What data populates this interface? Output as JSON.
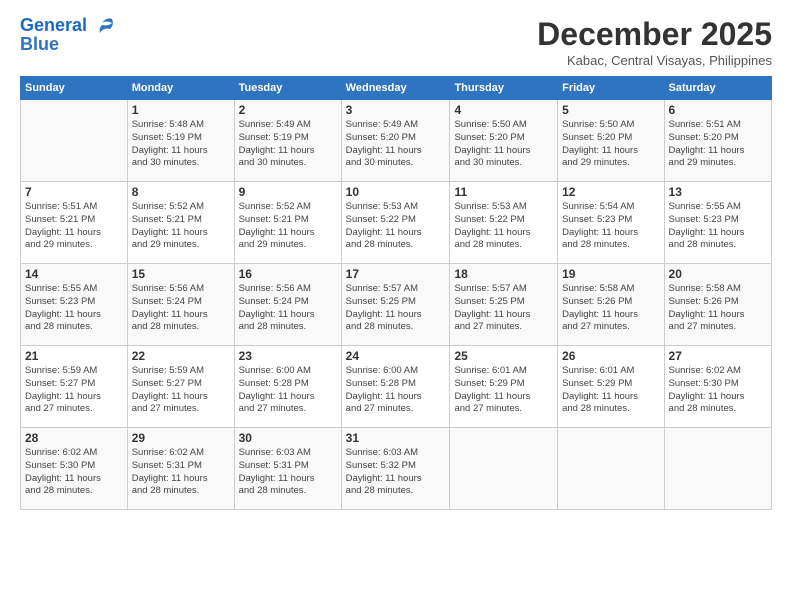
{
  "header": {
    "logo_line1": "General",
    "logo_line2": "Blue",
    "month_year": "December 2025",
    "location": "Kabac, Central Visayas, Philippines"
  },
  "days_of_week": [
    "Sunday",
    "Monday",
    "Tuesday",
    "Wednesday",
    "Thursday",
    "Friday",
    "Saturday"
  ],
  "weeks": [
    [
      {
        "day": "",
        "info": ""
      },
      {
        "day": "1",
        "info": "Sunrise: 5:48 AM\nSunset: 5:19 PM\nDaylight: 11 hours\nand 30 minutes."
      },
      {
        "day": "2",
        "info": "Sunrise: 5:49 AM\nSunset: 5:19 PM\nDaylight: 11 hours\nand 30 minutes."
      },
      {
        "day": "3",
        "info": "Sunrise: 5:49 AM\nSunset: 5:20 PM\nDaylight: 11 hours\nand 30 minutes."
      },
      {
        "day": "4",
        "info": "Sunrise: 5:50 AM\nSunset: 5:20 PM\nDaylight: 11 hours\nand 30 minutes."
      },
      {
        "day": "5",
        "info": "Sunrise: 5:50 AM\nSunset: 5:20 PM\nDaylight: 11 hours\nand 29 minutes."
      },
      {
        "day": "6",
        "info": "Sunrise: 5:51 AM\nSunset: 5:20 PM\nDaylight: 11 hours\nand 29 minutes."
      }
    ],
    [
      {
        "day": "7",
        "info": "Sunrise: 5:51 AM\nSunset: 5:21 PM\nDaylight: 11 hours\nand 29 minutes."
      },
      {
        "day": "8",
        "info": "Sunrise: 5:52 AM\nSunset: 5:21 PM\nDaylight: 11 hours\nand 29 minutes."
      },
      {
        "day": "9",
        "info": "Sunrise: 5:52 AM\nSunset: 5:21 PM\nDaylight: 11 hours\nand 29 minutes."
      },
      {
        "day": "10",
        "info": "Sunrise: 5:53 AM\nSunset: 5:22 PM\nDaylight: 11 hours\nand 28 minutes."
      },
      {
        "day": "11",
        "info": "Sunrise: 5:53 AM\nSunset: 5:22 PM\nDaylight: 11 hours\nand 28 minutes."
      },
      {
        "day": "12",
        "info": "Sunrise: 5:54 AM\nSunset: 5:23 PM\nDaylight: 11 hours\nand 28 minutes."
      },
      {
        "day": "13",
        "info": "Sunrise: 5:55 AM\nSunset: 5:23 PM\nDaylight: 11 hours\nand 28 minutes."
      }
    ],
    [
      {
        "day": "14",
        "info": "Sunrise: 5:55 AM\nSunset: 5:23 PM\nDaylight: 11 hours\nand 28 minutes."
      },
      {
        "day": "15",
        "info": "Sunrise: 5:56 AM\nSunset: 5:24 PM\nDaylight: 11 hours\nand 28 minutes."
      },
      {
        "day": "16",
        "info": "Sunrise: 5:56 AM\nSunset: 5:24 PM\nDaylight: 11 hours\nand 28 minutes."
      },
      {
        "day": "17",
        "info": "Sunrise: 5:57 AM\nSunset: 5:25 PM\nDaylight: 11 hours\nand 28 minutes."
      },
      {
        "day": "18",
        "info": "Sunrise: 5:57 AM\nSunset: 5:25 PM\nDaylight: 11 hours\nand 27 minutes."
      },
      {
        "day": "19",
        "info": "Sunrise: 5:58 AM\nSunset: 5:26 PM\nDaylight: 11 hours\nand 27 minutes."
      },
      {
        "day": "20",
        "info": "Sunrise: 5:58 AM\nSunset: 5:26 PM\nDaylight: 11 hours\nand 27 minutes."
      }
    ],
    [
      {
        "day": "21",
        "info": "Sunrise: 5:59 AM\nSunset: 5:27 PM\nDaylight: 11 hours\nand 27 minutes."
      },
      {
        "day": "22",
        "info": "Sunrise: 5:59 AM\nSunset: 5:27 PM\nDaylight: 11 hours\nand 27 minutes."
      },
      {
        "day": "23",
        "info": "Sunrise: 6:00 AM\nSunset: 5:28 PM\nDaylight: 11 hours\nand 27 minutes."
      },
      {
        "day": "24",
        "info": "Sunrise: 6:00 AM\nSunset: 5:28 PM\nDaylight: 11 hours\nand 27 minutes."
      },
      {
        "day": "25",
        "info": "Sunrise: 6:01 AM\nSunset: 5:29 PM\nDaylight: 11 hours\nand 27 minutes."
      },
      {
        "day": "26",
        "info": "Sunrise: 6:01 AM\nSunset: 5:29 PM\nDaylight: 11 hours\nand 28 minutes."
      },
      {
        "day": "27",
        "info": "Sunrise: 6:02 AM\nSunset: 5:30 PM\nDaylight: 11 hours\nand 28 minutes."
      }
    ],
    [
      {
        "day": "28",
        "info": "Sunrise: 6:02 AM\nSunset: 5:30 PM\nDaylight: 11 hours\nand 28 minutes."
      },
      {
        "day": "29",
        "info": "Sunrise: 6:02 AM\nSunset: 5:31 PM\nDaylight: 11 hours\nand 28 minutes."
      },
      {
        "day": "30",
        "info": "Sunrise: 6:03 AM\nSunset: 5:31 PM\nDaylight: 11 hours\nand 28 minutes."
      },
      {
        "day": "31",
        "info": "Sunrise: 6:03 AM\nSunset: 5:32 PM\nDaylight: 11 hours\nand 28 minutes."
      },
      {
        "day": "",
        "info": ""
      },
      {
        "day": "",
        "info": ""
      },
      {
        "day": "",
        "info": ""
      }
    ]
  ]
}
